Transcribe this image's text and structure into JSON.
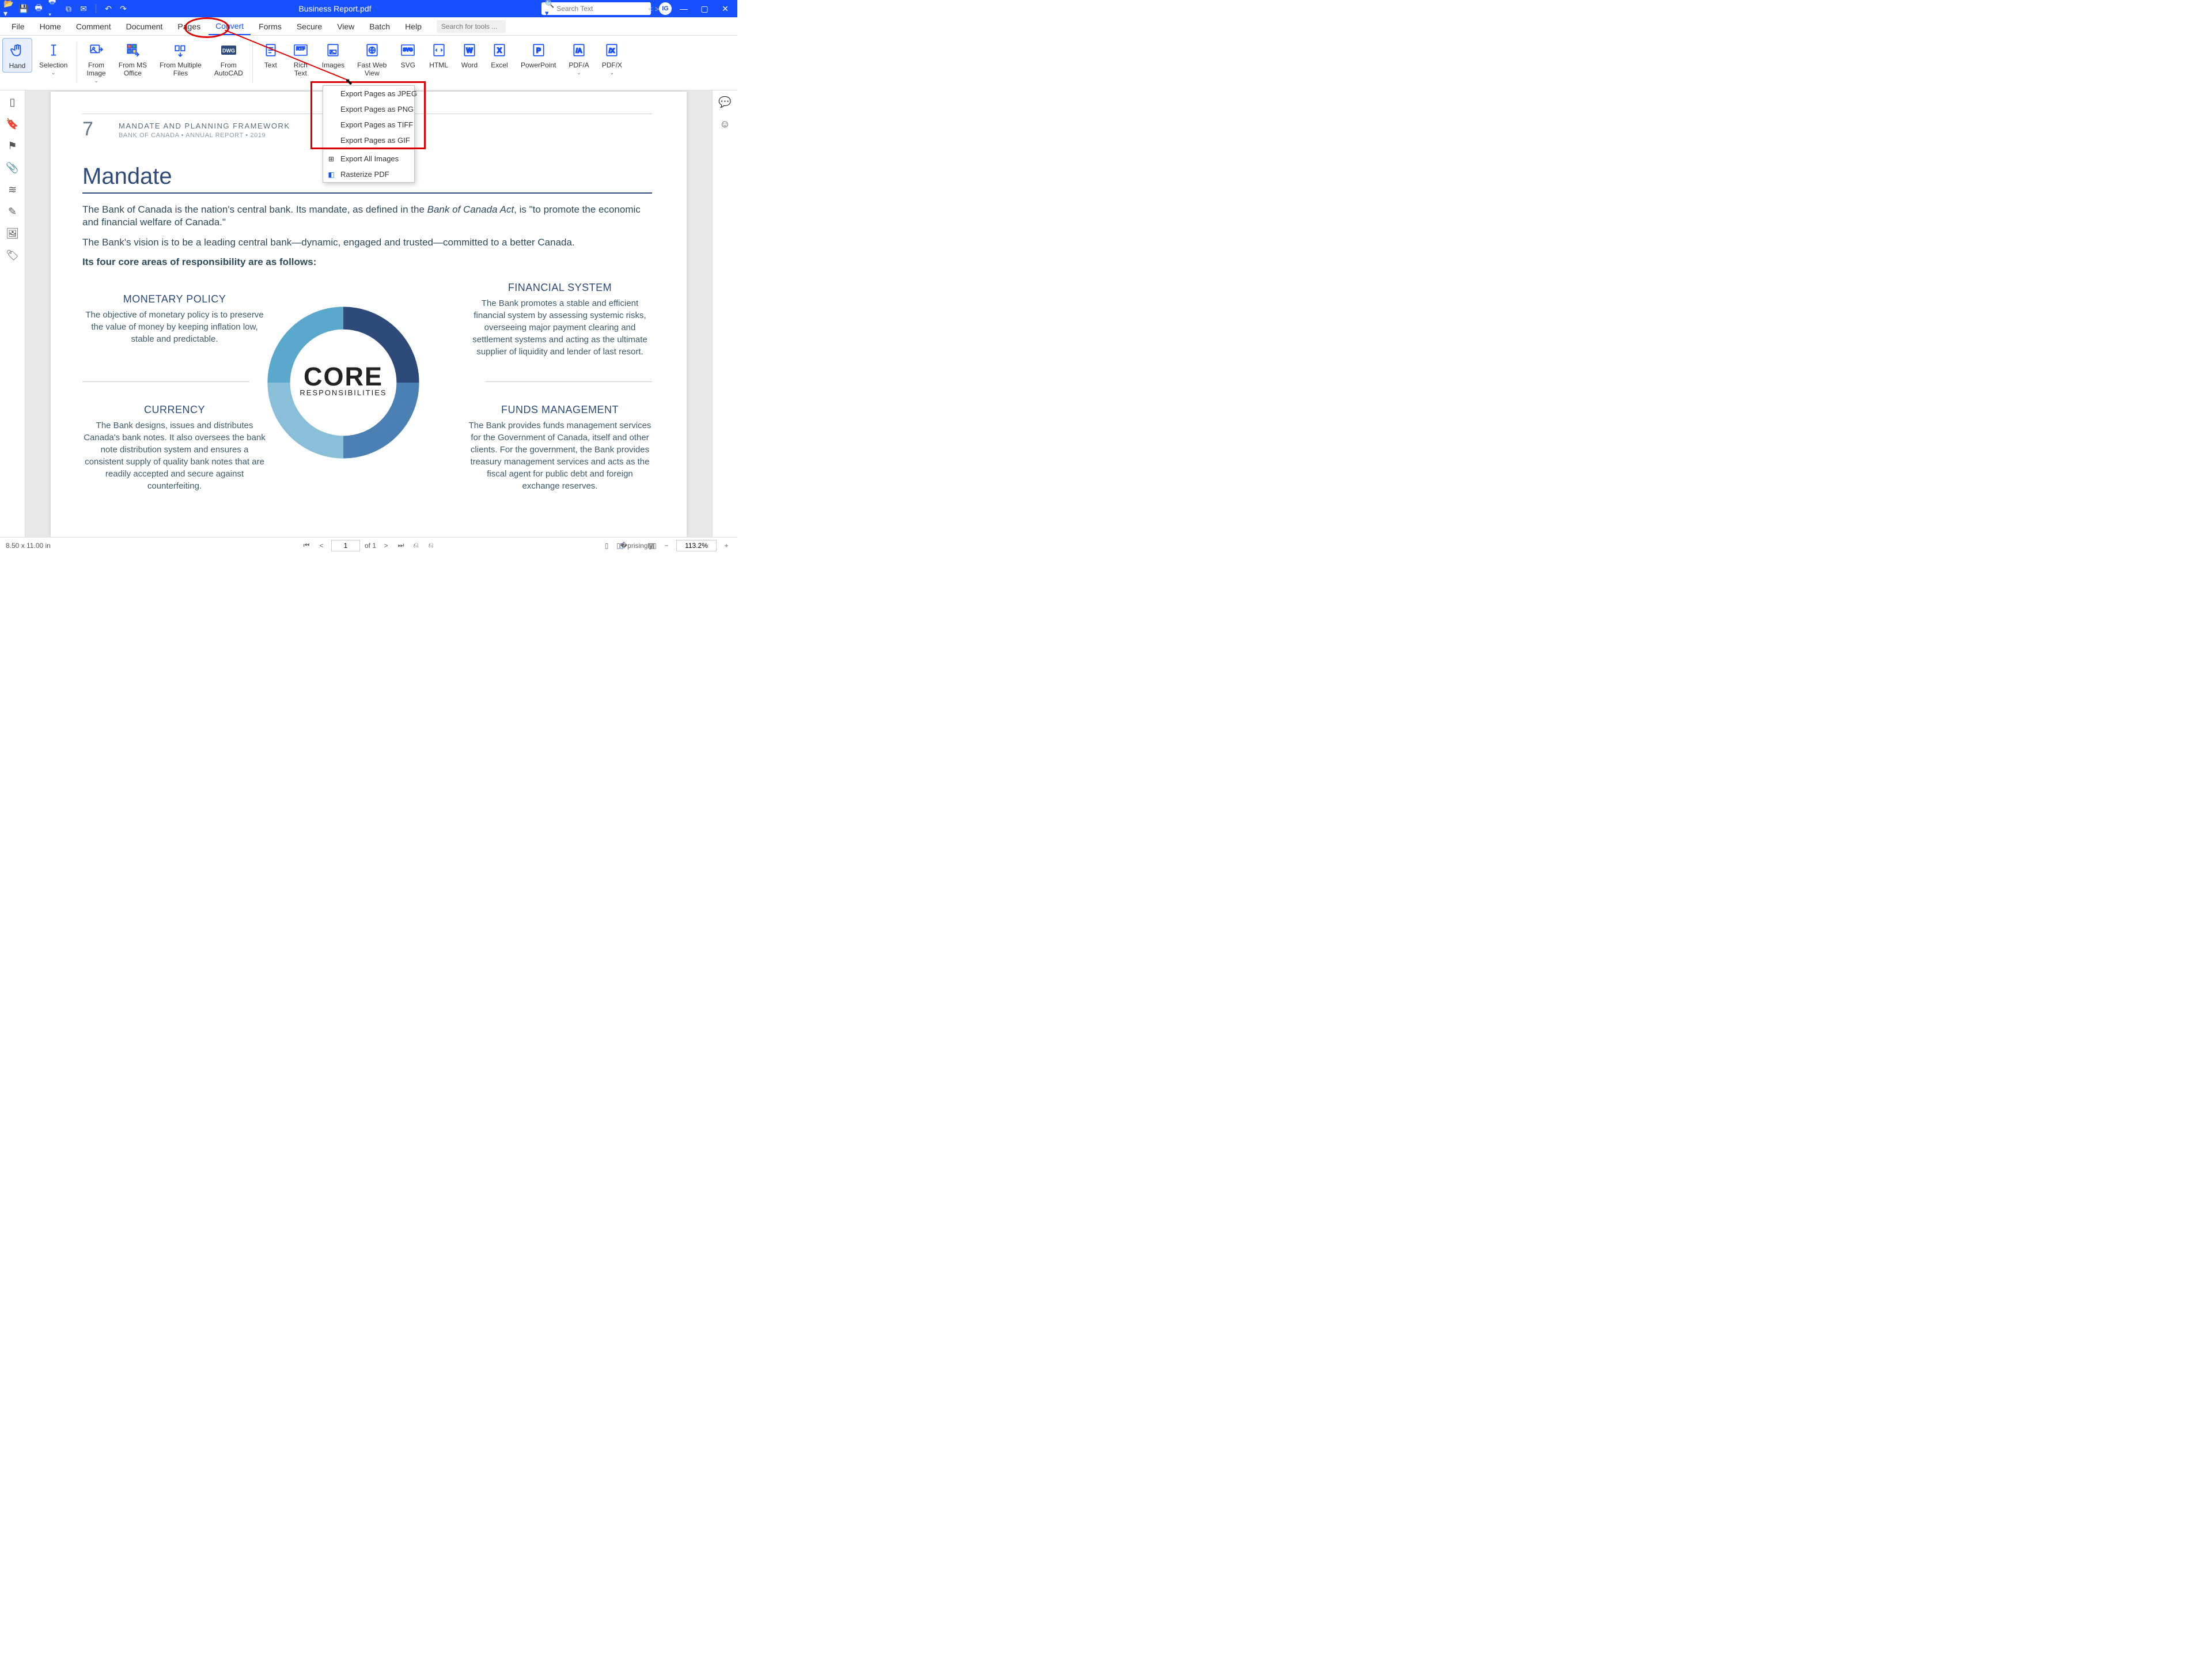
{
  "title": "Business Report.pdf",
  "search_placeholder": "Search Text",
  "user_initials": "IG",
  "menus": [
    "File",
    "Home",
    "Comment",
    "Document",
    "Pages",
    "Convert",
    "Forms",
    "Secure",
    "View",
    "Batch",
    "Help"
  ],
  "active_menu": "Convert",
  "tool_search_placeholder": "Search for tools ...",
  "ribbon": [
    {
      "label": "Hand",
      "dd": false,
      "sel": true
    },
    {
      "label": "Selection",
      "dd": true
    },
    {
      "label": "From\nImage",
      "dd": true
    },
    {
      "label": "From MS\nOffice",
      "dd": false
    },
    {
      "label": "From Multiple\nFiles",
      "dd": false
    },
    {
      "label": "From\nAutoCAD",
      "dd": false
    },
    {
      "label": "Text",
      "dd": false
    },
    {
      "label": "Rich\nText",
      "dd": false
    },
    {
      "label": "Images",
      "dd": true
    },
    {
      "label": "Fast Web\nView",
      "dd": false
    },
    {
      "label": "SVG",
      "dd": false
    },
    {
      "label": "HTML",
      "dd": false
    },
    {
      "label": "Word",
      "dd": false
    },
    {
      "label": "Excel",
      "dd": false
    },
    {
      "label": "PowerPoint",
      "dd": false
    },
    {
      "label": "PDF/A",
      "dd": true
    },
    {
      "label": "PDF/X",
      "dd": true
    }
  ],
  "images_menu": {
    "group1": [
      "Export Pages as JPEG",
      "Export Pages as PNG",
      "Export Pages as TIFF",
      "Export Pages as GIF"
    ],
    "group2": [
      "Export All Images",
      "Rasterize PDF"
    ]
  },
  "page": {
    "num": "7",
    "hdr1": "MANDATE AND PLANNING FRAMEWORK",
    "hdr2": "BANK OF CANADA  •  ANNUAL REPORT  •  2019",
    "title": "Mandate",
    "p1a": "The Bank of Canada is the nation's central bank. Its mandate, as defined in the ",
    "p1b": "Bank of Canada Act",
    "p1c": ", is \"to promote the economic and financial welfare of Canada.\"",
    "p2": "The Bank's vision is to be a leading central bank—dynamic, engaged and trusted—committed to a better Canada.",
    "p3": "Its four core areas of responsibility are as follows:",
    "donut": {
      "line1": "CORE",
      "line2": "RESPONSIBILITIES"
    },
    "q1h": "MONETARY POLICY",
    "q1b": "The objective of monetary policy is to preserve the value of money by keeping inflation low, stable and predictable.",
    "q2h": "FINANCIAL SYSTEM",
    "q2b": "The Bank promotes a stable and efficient financial system by assessing systemic risks, overseeing major payment clearing and settlement systems and acting as the ultimate supplier of liquidity and lender of  last resort.",
    "q3h": "CURRENCY",
    "q3b": "The Bank designs, issues and distributes Canada's bank notes. It also oversees the bank note distribution system and ensures a consistent supply of quality bank notes that are readily accepted and secure against counterfeiting.",
    "q4h": "FUNDS MANAGEMENT",
    "q4b": "The Bank provides funds management services for the Government of Canada, itself and other clients. For the government, the Bank provides treasury management services and acts as the fiscal agent for public debt and foreign exchange reserves."
  },
  "status": {
    "dim": "8.50 x 11.00 in",
    "page": "1",
    "of": "of 1",
    "zoom": "113.2%"
  }
}
